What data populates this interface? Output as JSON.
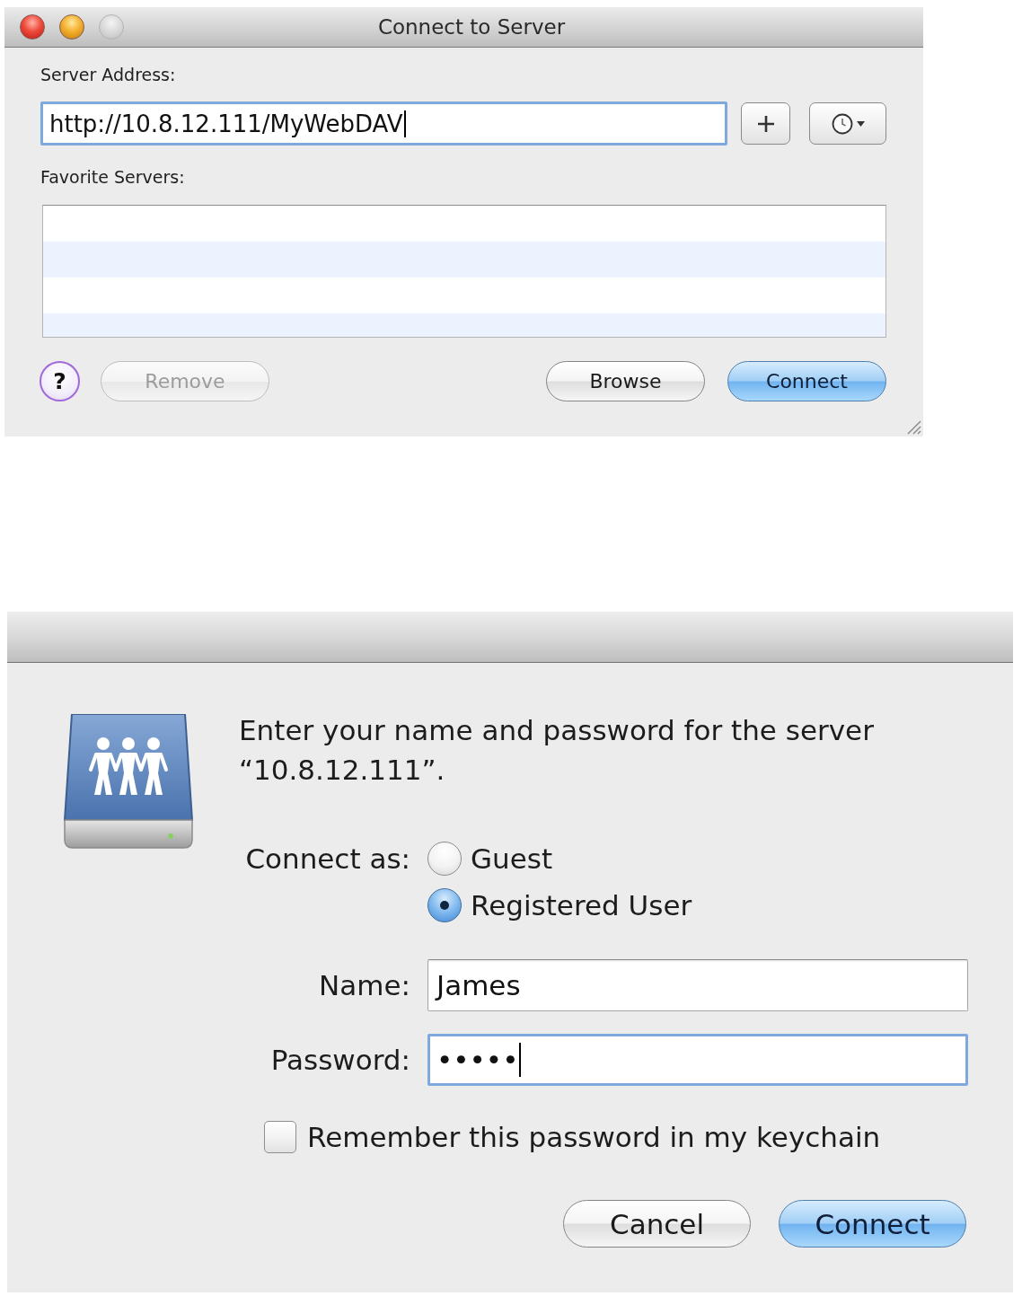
{
  "connect_window": {
    "title": "Connect to Server",
    "window_buttons": [
      {
        "kind": "close",
        "disabled": false
      },
      {
        "kind": "minimize",
        "disabled": false
      },
      {
        "kind": "zoom",
        "disabled": true
      }
    ],
    "server_address": {
      "label": "Server Address:",
      "value": "http://10.8.12.111/MyWebDAV",
      "focused": true
    },
    "favorites": {
      "label": "Favorite Servers:"
    },
    "help_button": "?",
    "left_buttons": [
      {
        "label": "Remove",
        "disabled": true,
        "default": false
      }
    ],
    "right_buttons": [
      {
        "label": "Browse",
        "disabled": false,
        "default": false
      },
      {
        "label": "Connect",
        "disabled": false,
        "default": true
      }
    ]
  },
  "auth_dialog": {
    "message": "Enter your name and password for the server “10.8.12.111”.",
    "connect_as": {
      "label": "Connect as:",
      "options": [
        {
          "label": "Guest",
          "selected": false
        },
        {
          "label": "Registered User",
          "selected": true
        }
      ]
    },
    "fields": [
      {
        "label": "Name:",
        "value": "James",
        "focused": false
      },
      {
        "label": "Password:",
        "value": "•••••",
        "focused": true
      }
    ],
    "remember": {
      "label": "Remember this password in my keychain",
      "checked": false
    },
    "buttons": [
      {
        "label": "Cancel",
        "default": false
      },
      {
        "label": "Connect",
        "default": true
      }
    ]
  }
}
